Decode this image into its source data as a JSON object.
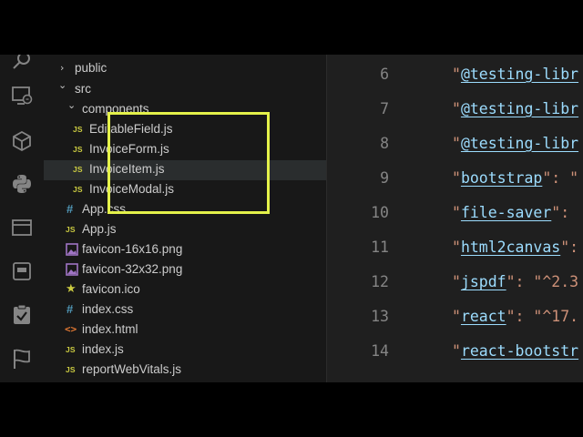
{
  "explorer": {
    "items": [
      {
        "label": "public",
        "chevron": "›",
        "icon": "chevron-right"
      },
      {
        "label": "src",
        "chevron": "⌄",
        "icon": "chevron-down"
      },
      {
        "label": "components",
        "chevron": "⌄",
        "icon": "chevron-down"
      },
      {
        "label": "EditableField.js",
        "badge": "JS",
        "icon": "javascript-file"
      },
      {
        "label": "InvoiceForm.js",
        "badge": "JS",
        "icon": "javascript-file"
      },
      {
        "label": "InvoiceItem.js",
        "badge": "JS",
        "icon": "javascript-file"
      },
      {
        "label": "InvoiceModal.js",
        "badge": "JS",
        "icon": "javascript-file"
      },
      {
        "label": "App.css",
        "badge": "#",
        "icon": "css-file"
      },
      {
        "label": "App.js",
        "badge": "JS",
        "icon": "javascript-file"
      },
      {
        "label": "favicon-16x16.png",
        "icon": "image-file"
      },
      {
        "label": "favicon-32x32.png",
        "icon": "image-file"
      },
      {
        "label": "favicon.ico",
        "badge": "★",
        "icon": "favicon-file"
      },
      {
        "label": "index.css",
        "badge": "#",
        "icon": "css-file"
      },
      {
        "label": "index.html",
        "badge": "<>",
        "icon": "html-file"
      },
      {
        "label": "index.js",
        "badge": "JS",
        "icon": "javascript-file"
      },
      {
        "label": "reportWebVitals.js",
        "badge": "JS",
        "icon": "javascript-file"
      }
    ],
    "selected_index": 5
  },
  "editor": {
    "lines": [
      {
        "num": "6",
        "key": "@testing-libr",
        "rest": ""
      },
      {
        "num": "7",
        "key": "@testing-libr",
        "rest": ""
      },
      {
        "num": "8",
        "key": "@testing-libr",
        "rest": ""
      },
      {
        "num": "9",
        "key": "bootstrap",
        "rest": "\": \""
      },
      {
        "num": "10",
        "key": "file-saver",
        "rest": "\":"
      },
      {
        "num": "11",
        "key": "html2canvas",
        "rest": "\":"
      },
      {
        "num": "12",
        "key": "jspdf",
        "rest": "\": \"^2.3"
      },
      {
        "num": "13",
        "key": "react",
        "rest": "\": \"^17."
      },
      {
        "num": "14",
        "key": "react-bootstr",
        "rest": ""
      }
    ]
  },
  "activity_bar": {
    "icons": [
      "search-icon",
      "remote-explorer-icon",
      "extensions-icon",
      "python-icon",
      "browser-icon",
      "panel-icon",
      "testing-icon",
      "flag-icon"
    ]
  },
  "colors": {
    "highlight_box": "#e4f14a",
    "js_badge": "#cbcb41",
    "css_badge": "#519aba",
    "html_badge": "#e37933",
    "image_icon": "#a074c4",
    "json_key": "#9cdcfe",
    "json_string": "#ce9178"
  }
}
